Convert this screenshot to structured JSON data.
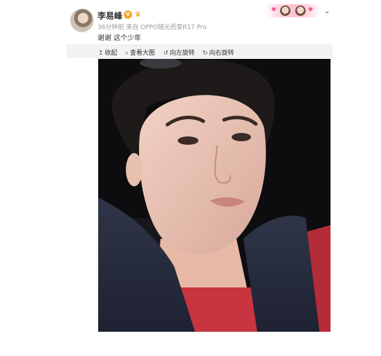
{
  "post": {
    "username": "李易峰",
    "verified_badge": "V",
    "meta": "36分钟前 来自 OPPO随光而变R17 Pro",
    "text": "谢谢 这个少年"
  },
  "toolbar": {
    "collapse": "收起",
    "view_large": "查看大图",
    "rotate_left": "向左旋转",
    "rotate_right": "向右旋转"
  },
  "icons": {
    "collapse": "collapse-up-icon",
    "view_large": "magnifier-icon",
    "rotate_left": "rotate-left-icon",
    "rotate_right": "rotate-right-icon",
    "more": "chevron-down-icon"
  },
  "colors": {
    "toolbar_bg": "#f2f2f5",
    "meta_text": "#999999",
    "badge": "#f5a623"
  }
}
